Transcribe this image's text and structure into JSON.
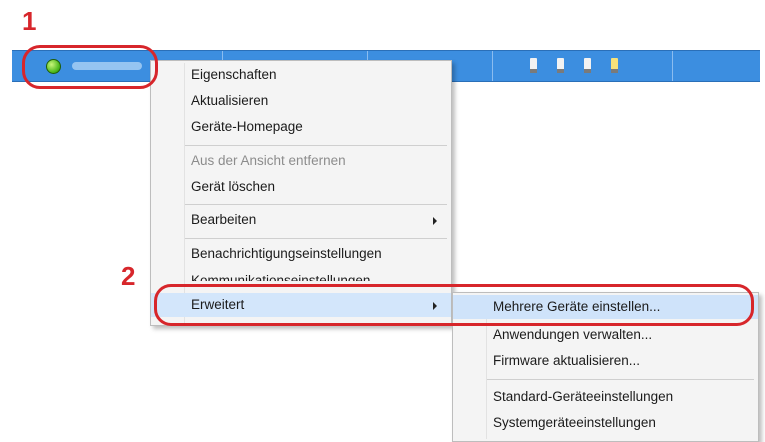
{
  "steps": {
    "one": "1",
    "two": "2"
  },
  "colors": {
    "accent": "#d7262b",
    "row": "#3c8ee0",
    "highlight": "#d3e6fb"
  },
  "device_row": {
    "status_icon": "green-status-dot-icon",
    "indicators": [
      "#f2f2f2",
      "#f2f2f2",
      "#f2f2f2",
      "#f7e27a"
    ]
  },
  "context_menu": {
    "properties": "Eigenschaften",
    "refresh": "Aktualisieren",
    "device_homepage": "Geräte-Homepage",
    "remove_from_view": "Aus der Ansicht entfernen",
    "delete_device": "Gerät löschen",
    "edit": "Bearbeiten",
    "notification_settings": "Benachrichtigungseinstellungen",
    "communication_settings": "Kommunikationseinstellungen",
    "advanced": "Erweitert"
  },
  "submenu": {
    "configure_multiple": "Mehrere Geräte einstellen...",
    "manage_apps": "Anwendungen verwalten...",
    "update_firmware": "Firmware aktualisieren...",
    "default_settings": "Standard-Geräteeinstellungen",
    "system_settings": "Systemgeräteeinstellungen"
  }
}
